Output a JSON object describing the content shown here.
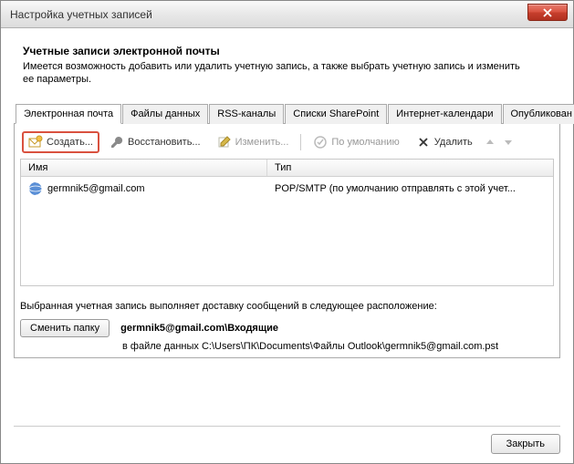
{
  "window": {
    "title": "Настройка учетных записей"
  },
  "header": {
    "title": "Учетные записи электронной почты",
    "desc": "Имеется возможность добавить или удалить учетную запись, а также выбрать учетную запись и изменить ее параметры."
  },
  "tabs": {
    "t0": "Электронная почта",
    "t1": "Файлы данных",
    "t2": "RSS-каналы",
    "t3": "Списки SharePoint",
    "t4": "Интернет-календари",
    "t5": "Опубликован"
  },
  "toolbar": {
    "create": "Создать...",
    "repair": "Восстановить...",
    "edit": "Изменить...",
    "default": "По умолчанию",
    "delete": "Удалить"
  },
  "list": {
    "col_name": "Имя",
    "col_type": "Тип",
    "rows": [
      {
        "name": "germnik5@gmail.com",
        "type": "POP/SMTP (по умолчанию отправлять с этой учет..."
      }
    ]
  },
  "footer": {
    "intro": "Выбранная учетная запись выполняет доставку сообщений в следующее расположение:",
    "change_btn": "Сменить папку",
    "location": "germnik5@gmail.com\\Входящие",
    "path": "в файле данных C:\\Users\\ПК\\Documents\\Файлы Outlook\\germnik5@gmail.com.pst"
  },
  "buttons": {
    "close": "Закрыть"
  }
}
